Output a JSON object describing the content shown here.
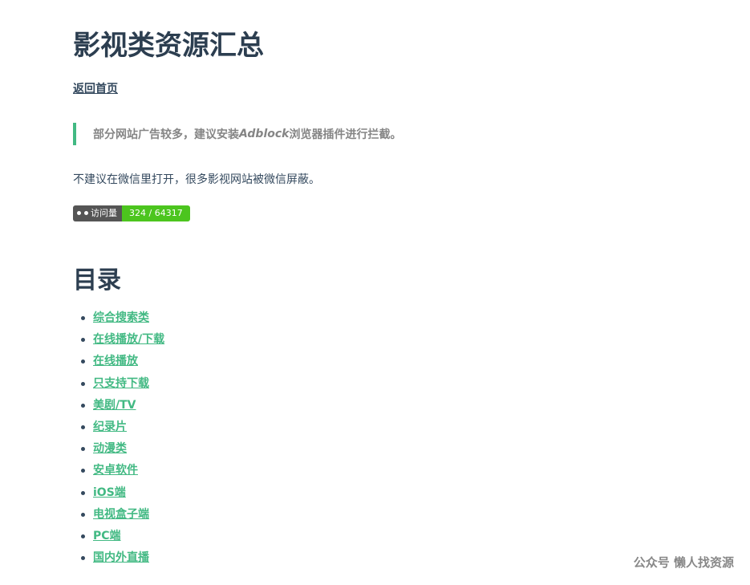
{
  "page": {
    "title": "影视类资源汇总",
    "back_link": "返回首页",
    "tip": {
      "before": "部分网站广告较多，建议安装",
      "emphasis": "Adblock",
      "after": "浏览器插件进行拦截。"
    },
    "notice": "不建议在微信里打开，很多影视网站被微信屏蔽。",
    "badge": {
      "label": "访问量",
      "value": "324 / 64317",
      "icon": "glasses-icon",
      "label_color": "#555555",
      "value_color": "#4cc51e"
    }
  },
  "toc": {
    "title": "目录",
    "items": [
      "综合搜索类",
      "在线播放/下载",
      "在线播放",
      "只支持下载",
      "美剧/TV",
      "纪录片",
      "动漫类",
      "安卓软件",
      "iOS端",
      "电视盒子端",
      "PC端",
      "国内外直播"
    ]
  },
  "watermark": "公众号  懒人找资源",
  "colors": {
    "accent": "#42b983",
    "heading": "#2c3e50",
    "text": "#34495e"
  }
}
